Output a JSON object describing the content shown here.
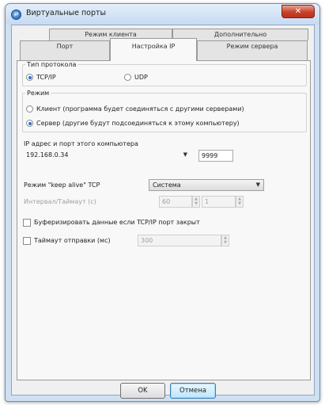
{
  "window": {
    "title": "Виртуальные порты",
    "close_label": "✕"
  },
  "tabs_row1": [
    "Режим клиента",
    "Дополнительно"
  ],
  "tabs_row2": [
    "Порт",
    "Настройка IP",
    "Режим сервера"
  ],
  "protocol": {
    "title": "Тип протокола",
    "options": [
      {
        "label": "TCP/IP",
        "checked": true
      },
      {
        "label": "UDP",
        "checked": false
      }
    ]
  },
  "mode": {
    "title": "Режим",
    "options": [
      {
        "label": "Клиент (программа будет соединяться с другими серверами)",
        "checked": false
      },
      {
        "label": "Сервер (другие будут подсоединяться к этому компьютеру)",
        "checked": true
      }
    ]
  },
  "ip": {
    "label": "IP адрес и порт этого компьютера",
    "address": "192.168.0.34",
    "port": "9999"
  },
  "keepalive": {
    "label": "Режим \"keep alive\" TCP",
    "value": "Система"
  },
  "interval": {
    "label": "Интервал/Таймаут (с)",
    "value1": "60",
    "value2": "1"
  },
  "buffer": {
    "label": "Буферизировать данные если TCP/IP порт закрыт",
    "checked": false
  },
  "send_timeout": {
    "label": "Таймаут отправки (мс)",
    "value": "300",
    "checked": false
  },
  "buttons": {
    "ok": "OK",
    "cancel": "Отмена"
  }
}
